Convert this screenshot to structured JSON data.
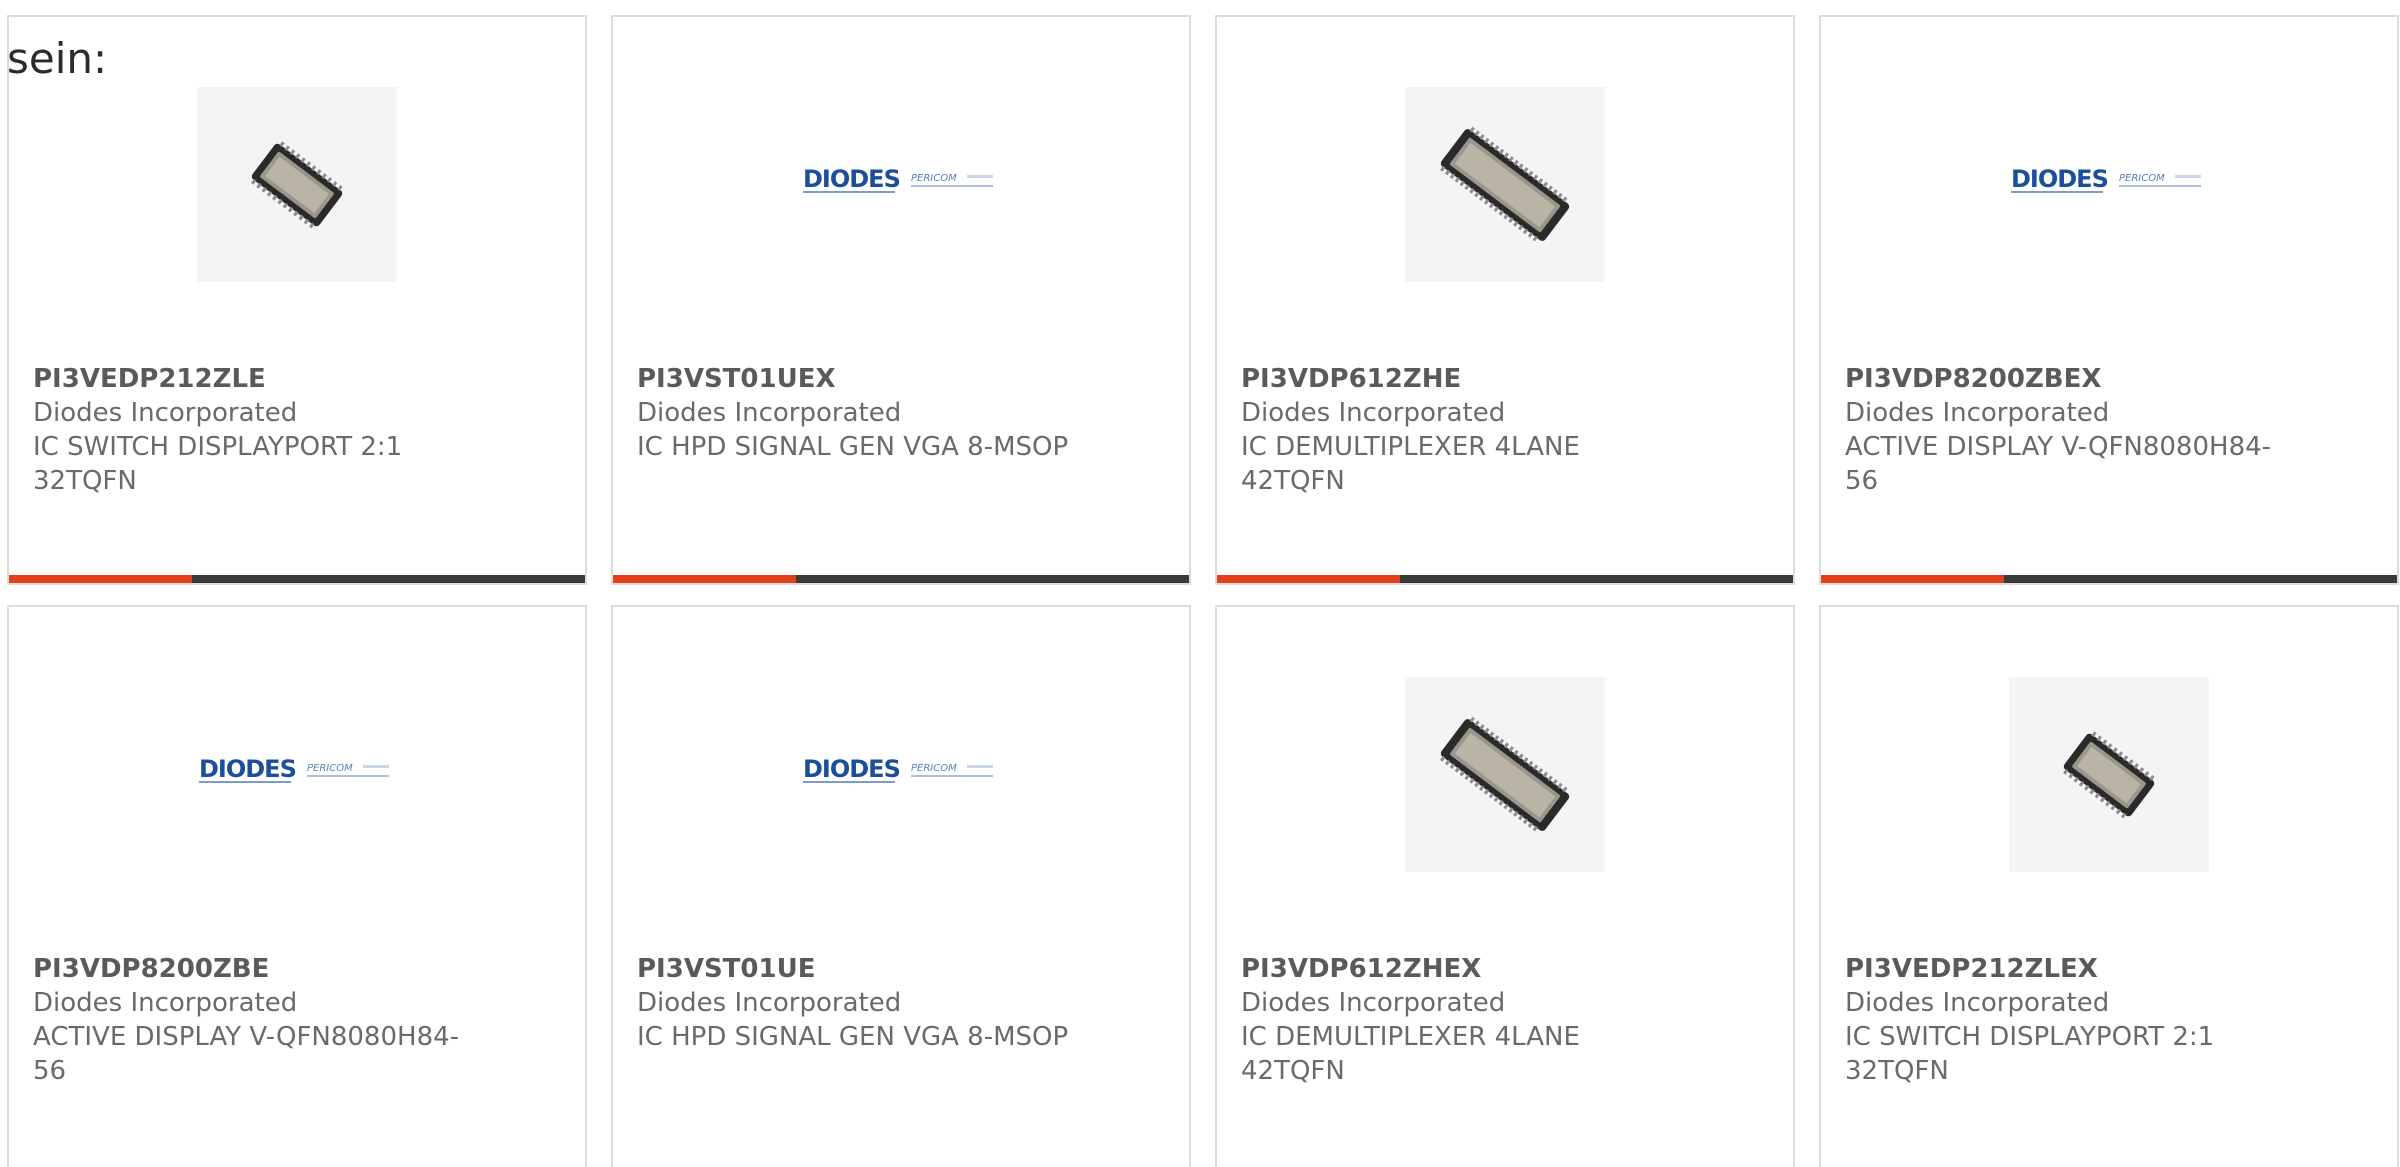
{
  "intro_text": "sein:",
  "colors": {
    "accent": "#e2401b",
    "bar": "#3a3a3a",
    "text": "#6a6a6a",
    "border": "#dcdcdc",
    "diodes_blue": "#1b4f9c"
  },
  "logo": {
    "brand": "DIODES",
    "sub": "PERICOM"
  },
  "products": [
    {
      "part": "PI3VEDP212ZLE",
      "maker": "Diodes Incorporated",
      "desc": "IC SWITCH DISPLAYPORT 2:1 32TQFN",
      "image": "qfn-small-chip"
    },
    {
      "part": "PI3VST01UEX",
      "maker": "Diodes Incorporated",
      "desc": "IC HPD SIGNAL GEN VGA 8-MSOP",
      "image": "diodes-logo"
    },
    {
      "part": "PI3VDP612ZHE",
      "maker": "Diodes Incorporated",
      "desc": "IC DEMULTIPLEXER 4LANE 42TQFN",
      "image": "qfn-long-chip"
    },
    {
      "part": "PI3VDP8200ZBEX",
      "maker": "Diodes Incorporated",
      "desc": "ACTIVE DISPLAY V-QFN8080H84-56",
      "image": "diodes-logo"
    },
    {
      "part": "PI3VDP8200ZBE",
      "maker": "Diodes Incorporated",
      "desc": "ACTIVE DISPLAY V-QFN8080H84-56",
      "image": "diodes-logo"
    },
    {
      "part": "PI3VST01UE",
      "maker": "Diodes Incorporated",
      "desc": "IC HPD SIGNAL GEN VGA 8-MSOP",
      "image": "diodes-logo"
    },
    {
      "part": "PI3VDP612ZHEX",
      "maker": "Diodes Incorporated",
      "desc": "IC DEMULTIPLEXER 4LANE 42TQFN",
      "image": "qfn-long-chip"
    },
    {
      "part": "PI3VEDP212ZLEX",
      "maker": "Diodes Incorporated",
      "desc": "IC SWITCH DISPLAYPORT 2:1 32TQFN",
      "image": "qfn-small-chip"
    }
  ]
}
